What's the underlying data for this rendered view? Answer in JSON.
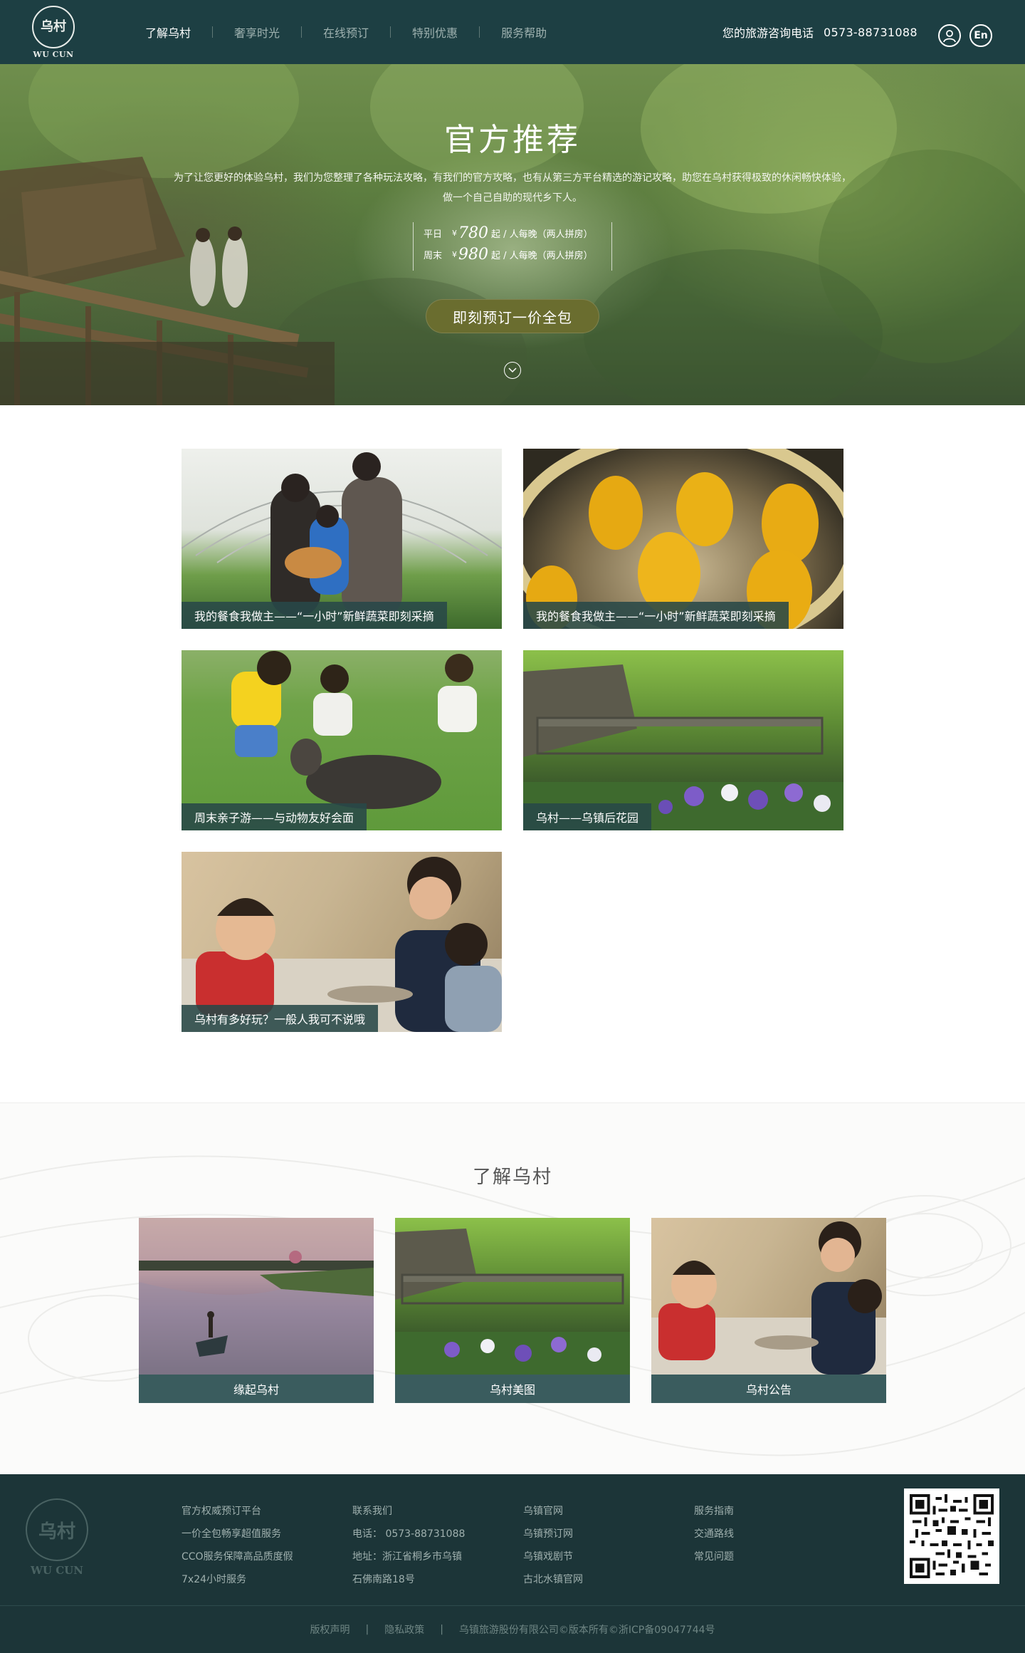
{
  "header": {
    "logo_text": "WU CUN",
    "logo_glyph": "乌村",
    "nav": [
      "了解乌村",
      "奢享时光",
      "在线预订",
      "特别优惠",
      "服务帮助"
    ],
    "hotline_label": "您的旅游咨询电话",
    "hotline_number": "0573-88731088",
    "lang_label": "En"
  },
  "hero": {
    "title": "官方推荐",
    "desc_line1": "为了让您更好的体验乌村，我们为您整理了各种玩法攻略，有我们的官方攻略，也有从第三方平台精选的游记攻略，助您在乌村获得极致的休闲畅快体验，",
    "desc_line2": "做一个自己自助的现代乡下人。",
    "weekday_label": "平日",
    "weekday_price": "780",
    "weekend_label": "周末",
    "weekend_price": "980",
    "currency": "¥",
    "price_suffix": "起 / 人每晚（两人拼房）",
    "book_button": "即刻预订一价全包"
  },
  "recommend": {
    "cards": [
      "我的餐食我做主——“一小时”新鲜蔬菜即刻采摘",
      "我的餐食我做主——“一小时”新鲜蔬菜即刻采摘",
      "周末亲子游——与动物友好会面",
      "乌村——乌镇后花园",
      "乌村有多好玩？一般人我可不说哦"
    ]
  },
  "learn": {
    "title": "了解乌村",
    "cards": [
      "缘起乌村",
      "乌村美图",
      "乌村公告"
    ]
  },
  "footer": {
    "logo_text": "WU CUN",
    "col1": [
      "官方权威预订平台",
      "一价全包畅享超值服务",
      "CCO服务保障高品质度假",
      "7x24小时服务"
    ],
    "col2": [
      "联系我们",
      "电话：  0573-88731088",
      "地址：浙江省桐乡市乌镇",
      "石佛南路18号"
    ],
    "col3": [
      "乌镇官网",
      "乌镇预订网",
      "乌镇戏剧节",
      "古北水镇官网"
    ],
    "col4": [
      "服务指南",
      "交通路线",
      "常见问题"
    ],
    "bottom": [
      "版权声明",
      "隐私政策",
      "乌镇旅游股份有限公司©版本所有©浙ICP备09047744号"
    ],
    "separator": "|"
  },
  "colors": {
    "header_bg": "#1d3f43",
    "caption_bg": "#284848",
    "footer_bg": "#1c3538",
    "button_bg": "#6a6d2f"
  }
}
